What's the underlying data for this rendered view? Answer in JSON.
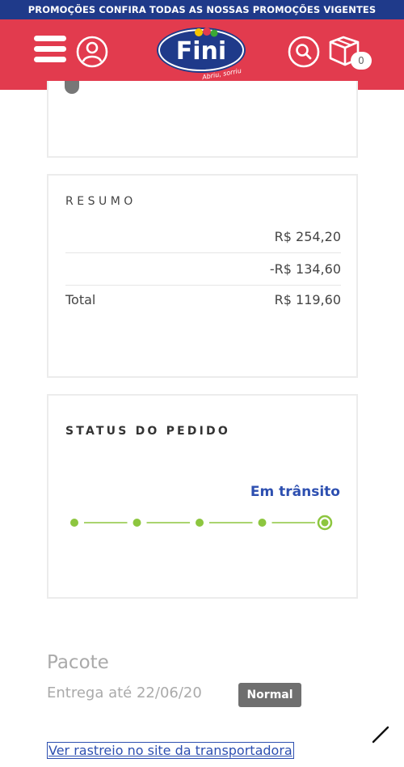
{
  "promo_bar": {
    "text": "PROMOÇÕES CONFIRA TODAS AS NOSSAS PROMOÇÕES VIGENTES"
  },
  "header": {
    "logo_text": "Fini",
    "logo_tagline": "Abriu, sorriu",
    "cart_count": "0",
    "colors": {
      "header_bg": "#e23b4e",
      "promo_bg": "#1f3a8a",
      "logo_bg": "#1f3a8a"
    }
  },
  "resumo": {
    "title": "RESUMO",
    "rows": [
      {
        "label": "",
        "value": "R$ 254,20"
      },
      {
        "label": "",
        "value": "-R$ 134,60"
      },
      {
        "label": "Total",
        "value": "R$ 119,60"
      }
    ]
  },
  "status": {
    "title": "STATUS DO PEDIDO",
    "current": "Em trânsito",
    "steps_total": 5,
    "current_step": 5,
    "colors": {
      "progress": "#8dc63f",
      "current_text": "#2d4fb0"
    }
  },
  "pacote": {
    "title": "Pacote",
    "entrega": "Entrega até 22/06/20",
    "badge": "Normal",
    "tracking_link": "Ver rastreio no site da transportadora"
  }
}
